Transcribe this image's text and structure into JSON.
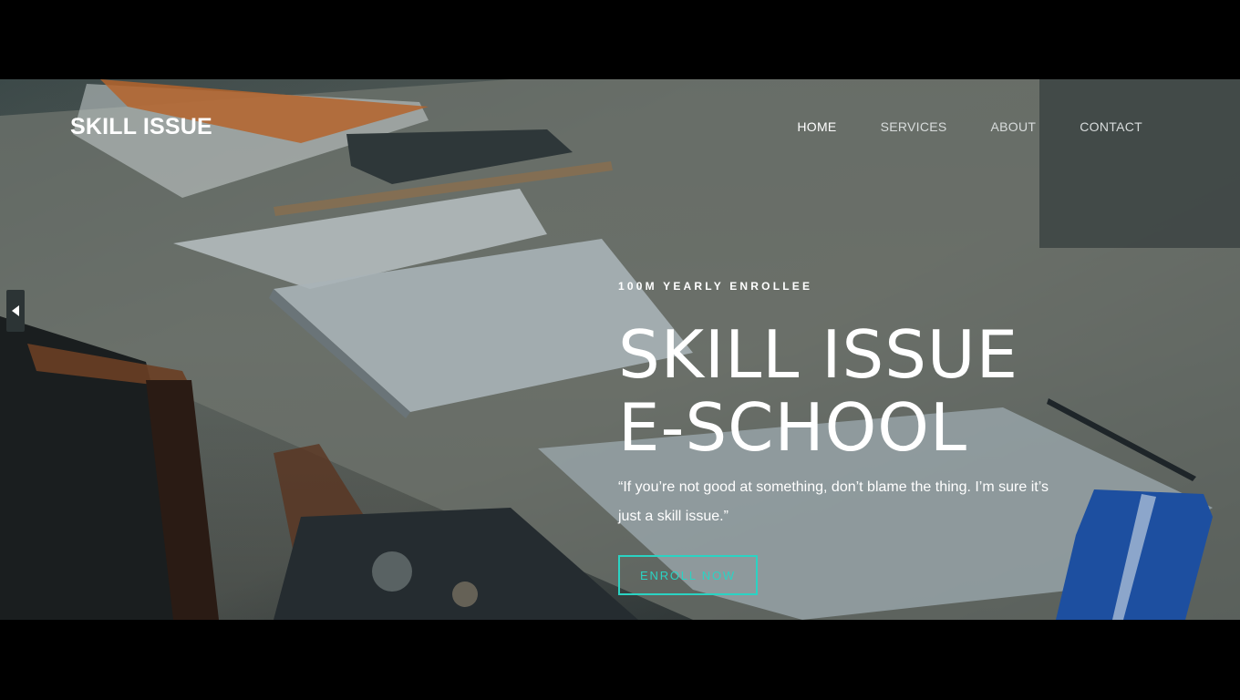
{
  "brand": "SKILL ISSUE",
  "nav": {
    "items": [
      {
        "label": "HOME",
        "active": true
      },
      {
        "label": "SERVICES",
        "active": false
      },
      {
        "label": "ABOUT",
        "active": false
      },
      {
        "label": "CONTACT",
        "active": false
      }
    ]
  },
  "hero": {
    "eyebrow": "100M YEARLY ENROLLEE",
    "title_line1": "SKILL ISSUE",
    "title_line2": "E-SCHOOL",
    "quote_line1": "“If you’re not good at something, don’t blame the thing. I’m sure it’s",
    "quote_line2": "just a skill issue.”",
    "cta_label": "ENROLL NOW"
  },
  "colors": {
    "accent": "#2bd3c3",
    "overlay": "#0a161a"
  },
  "icons": {
    "slider_prev": "triangle-left-icon"
  }
}
